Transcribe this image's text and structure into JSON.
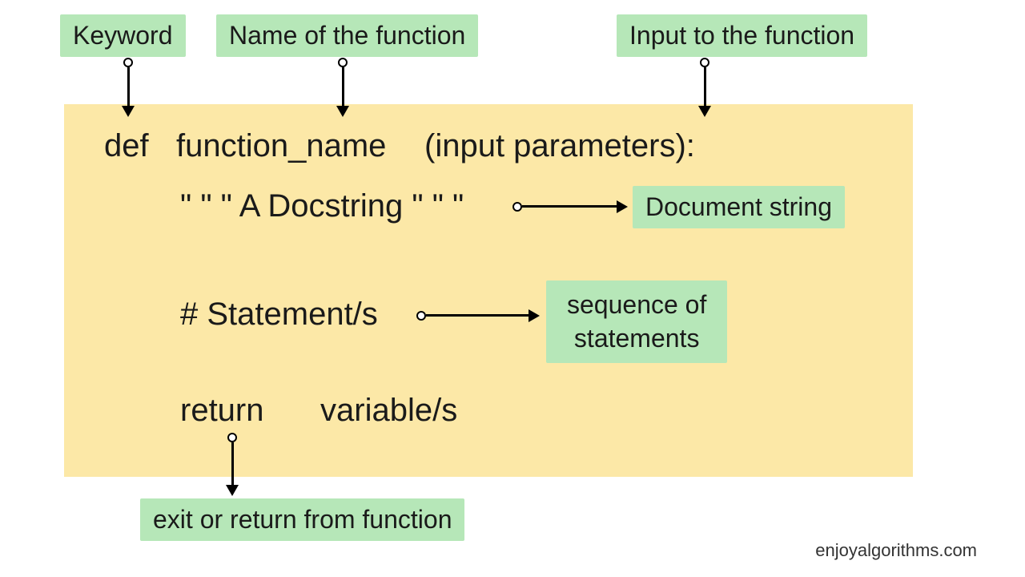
{
  "labels": {
    "keyword": "Keyword",
    "function_name": "Name of the function",
    "input": "Input to the function",
    "docstring": "Document string",
    "statements_line1": "sequence of",
    "statements_line2": "statements",
    "return": "exit or return from function"
  },
  "code": {
    "def": "def",
    "fname": "function_name",
    "params": "(input parameters):",
    "docstring": "\" \" \" A Docstring \" \" \"",
    "statements": "# Statement/s",
    "return_kw": "return",
    "return_var": "variable/s"
  },
  "watermark": "enjoyalgorithms.com"
}
